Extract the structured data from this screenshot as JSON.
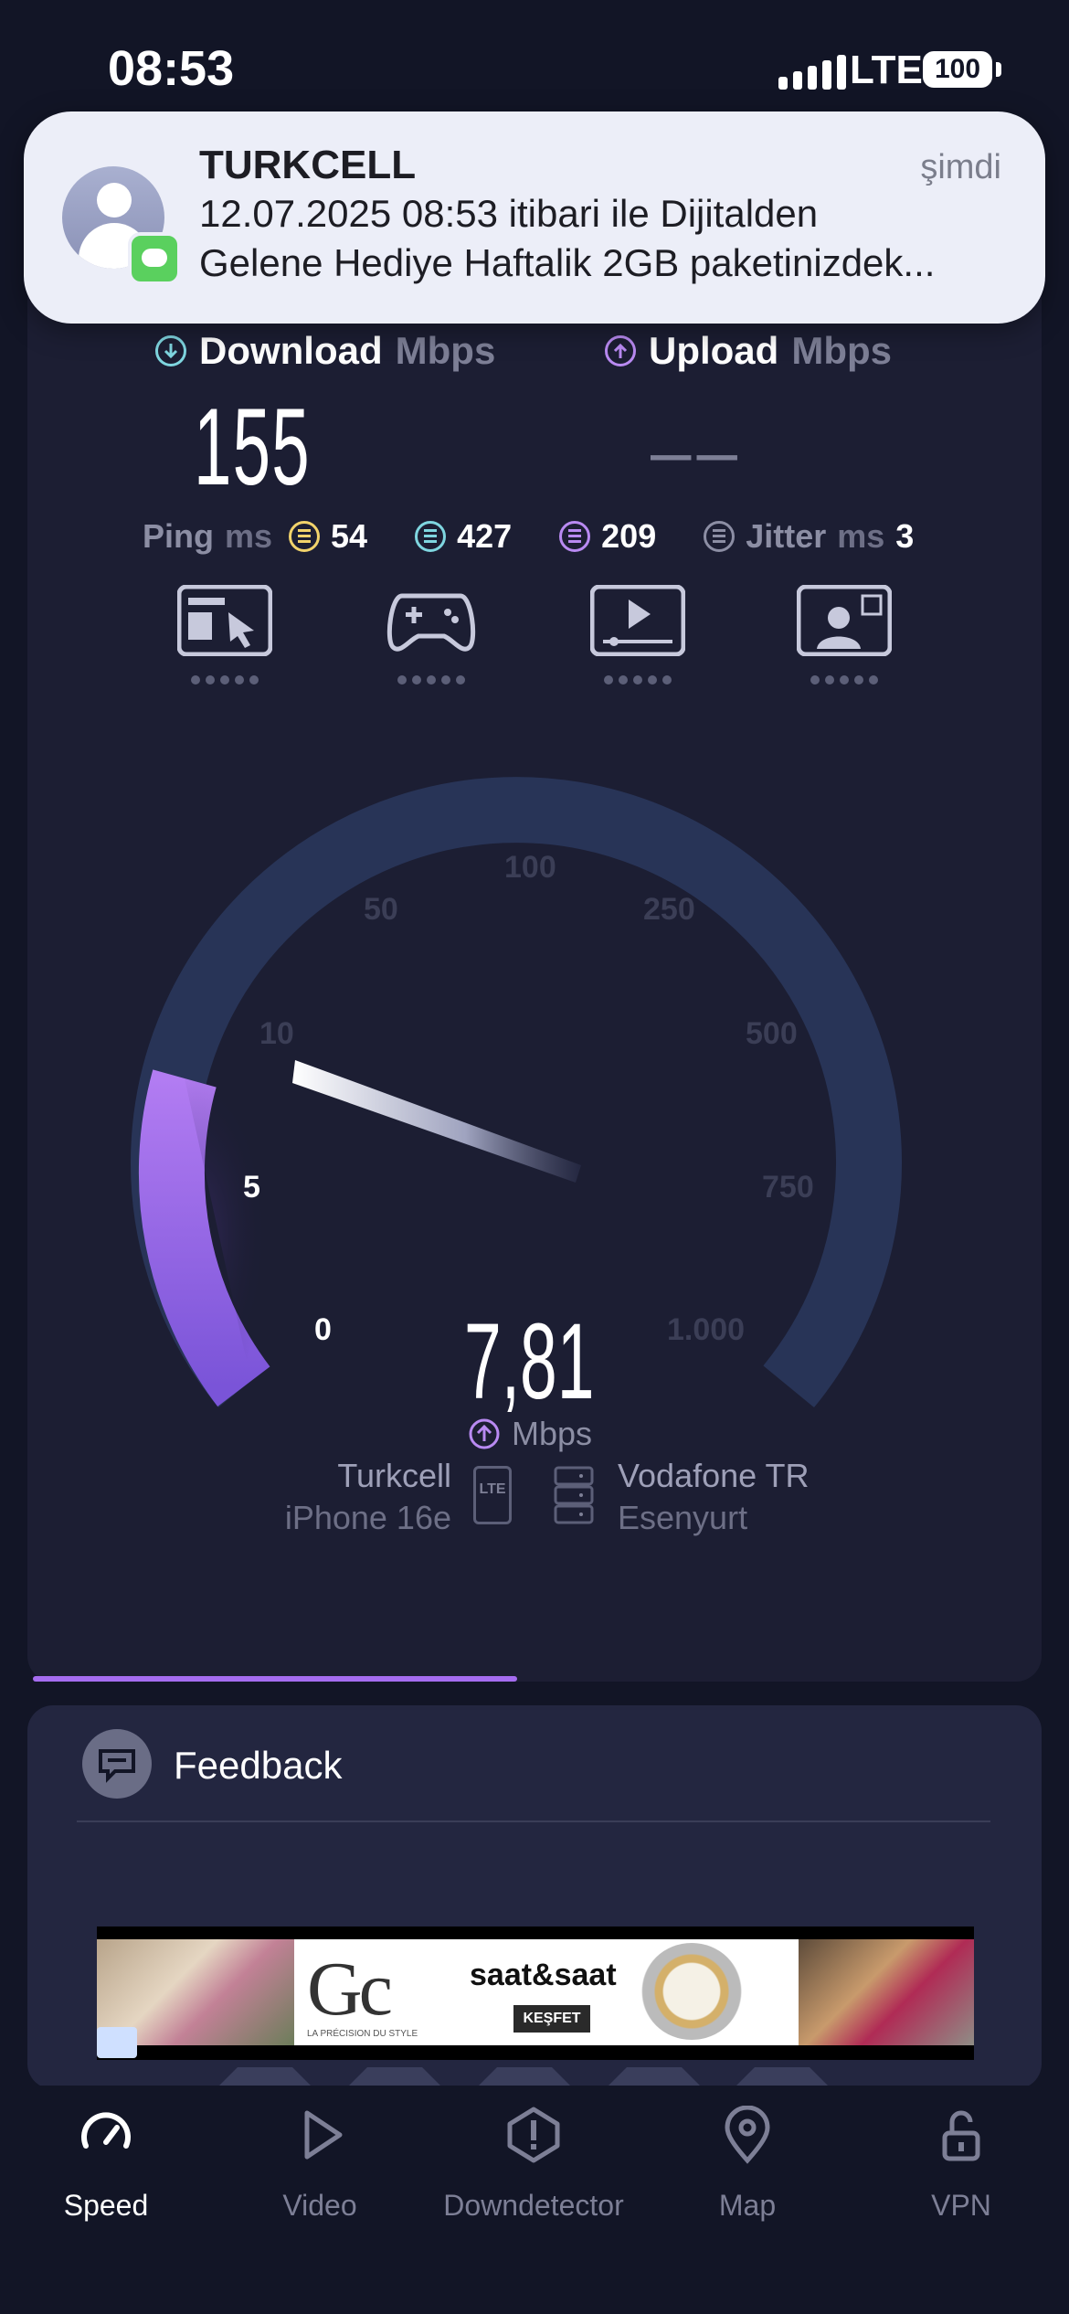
{
  "status_bar": {
    "time": "08:53",
    "network": "LTE",
    "battery": "100"
  },
  "notification": {
    "sender": "TURKCELL",
    "time": "şimdi",
    "line1": "12.07.2025 08:53 itibari ile Dijitalden",
    "line2": "Gelene Hediye Haftalik 2GB paketinizdek..."
  },
  "speed": {
    "download": {
      "label": "Download",
      "unit": "Mbps",
      "value": "155"
    },
    "upload": {
      "label": "Upload",
      "unit": "Mbps",
      "value": "––"
    },
    "ping": {
      "label": "Ping",
      "unit": "ms",
      "idle": "54",
      "download": "427",
      "upload": "209"
    },
    "jitter": {
      "label": "Jitter",
      "unit": "ms",
      "value": "3"
    },
    "services": [
      "web-browsing",
      "gaming",
      "video-streaming",
      "video-calls"
    ]
  },
  "gauge": {
    "ticks": [
      "0",
      "5",
      "10",
      "50",
      "100",
      "250",
      "500",
      "750",
      "1.000"
    ],
    "current_value": "7,81",
    "unit": "Mbps",
    "progress_fraction": 0.48
  },
  "connection": {
    "provider": "Turkcell",
    "device": "iPhone 16e",
    "provider_icon_text": "LTE",
    "server_name": "Vodafone TR",
    "server_location": "Esenyurt"
  },
  "feedback": {
    "title": "Feedback"
  },
  "ad": {
    "logo": "Gc",
    "tagline": "LA PRÉCISION DU STYLE",
    "brand": "saat&saat",
    "cta": "KEŞFET"
  },
  "tabs": [
    {
      "label": "Speed",
      "icon": "speedometer-icon"
    },
    {
      "label": "Video",
      "icon": "play-icon"
    },
    {
      "label": "Downdetector",
      "icon": "alert-icon"
    },
    {
      "label": "Map",
      "icon": "map-pin-icon"
    },
    {
      "label": "VPN",
      "icon": "unlock-icon"
    }
  ],
  "colors": {
    "accent": "#a56cf0",
    "download": "#7fd6e0",
    "ping_idle": "#f2d36b",
    "background": "#121526",
    "card": "#1c1e33"
  }
}
